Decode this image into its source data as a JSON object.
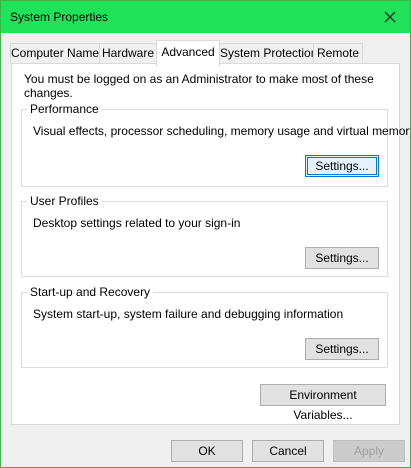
{
  "window": {
    "title": "System Properties"
  },
  "tabs": [
    {
      "label": "Computer Name",
      "active": false
    },
    {
      "label": "Hardware",
      "active": false
    },
    {
      "label": "Advanced",
      "active": true
    },
    {
      "label": "System Protection",
      "active": false
    },
    {
      "label": "Remote",
      "active": false
    }
  ],
  "advanced": {
    "admin_note": "You must be logged on as an Administrator to make most of these changes.",
    "performance": {
      "legend": "Performance",
      "description": "Visual effects, processor scheduling, memory usage and virtual memory",
      "button": "Settings..."
    },
    "user_profiles": {
      "legend": "User Profiles",
      "description": "Desktop settings related to your sign-in",
      "button": "Settings..."
    },
    "startup_recovery": {
      "legend": "Start-up and Recovery",
      "description": "System start-up, system failure and debugging information",
      "button": "Settings..."
    },
    "environment_button": "Environment Variables..."
  },
  "footer": {
    "ok": "OK",
    "cancel": "Cancel",
    "apply": "Apply"
  },
  "colors": {
    "titlebar": "#1fe25a",
    "window_border": "#3bb54a",
    "focus": "#0078d7"
  },
  "icons": {
    "close": "close-icon"
  }
}
